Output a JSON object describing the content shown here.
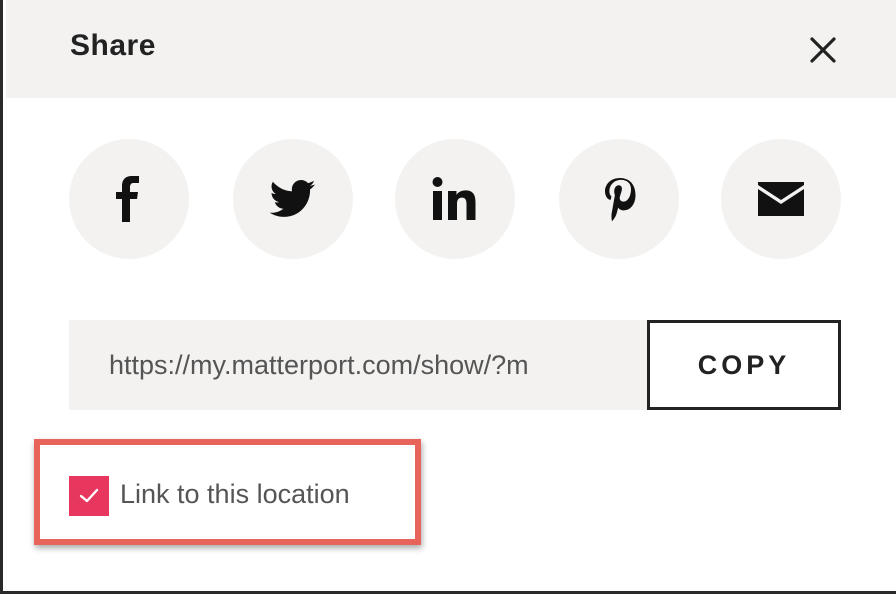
{
  "dialog": {
    "title": "Share",
    "close_icon": "close-icon"
  },
  "social": [
    {
      "name": "facebook",
      "icon": "facebook-icon"
    },
    {
      "name": "twitter",
      "icon": "twitter-icon"
    },
    {
      "name": "linkedin",
      "icon": "linkedin-icon"
    },
    {
      "name": "pinterest",
      "icon": "pinterest-icon"
    },
    {
      "name": "email",
      "icon": "envelope-icon"
    }
  ],
  "link": {
    "url": "https://my.matterport.com/show/?m",
    "copy_label": "COPY"
  },
  "location_option": {
    "label": "Link to this location",
    "checked": true
  },
  "colors": {
    "header_bg": "#f3f2f1",
    "icon_circle_bg": "#f3f2f1",
    "checkbox": "#e8375e",
    "highlight_outline": "#e8635a",
    "text_dark": "#222222",
    "text_muted": "#555555"
  }
}
